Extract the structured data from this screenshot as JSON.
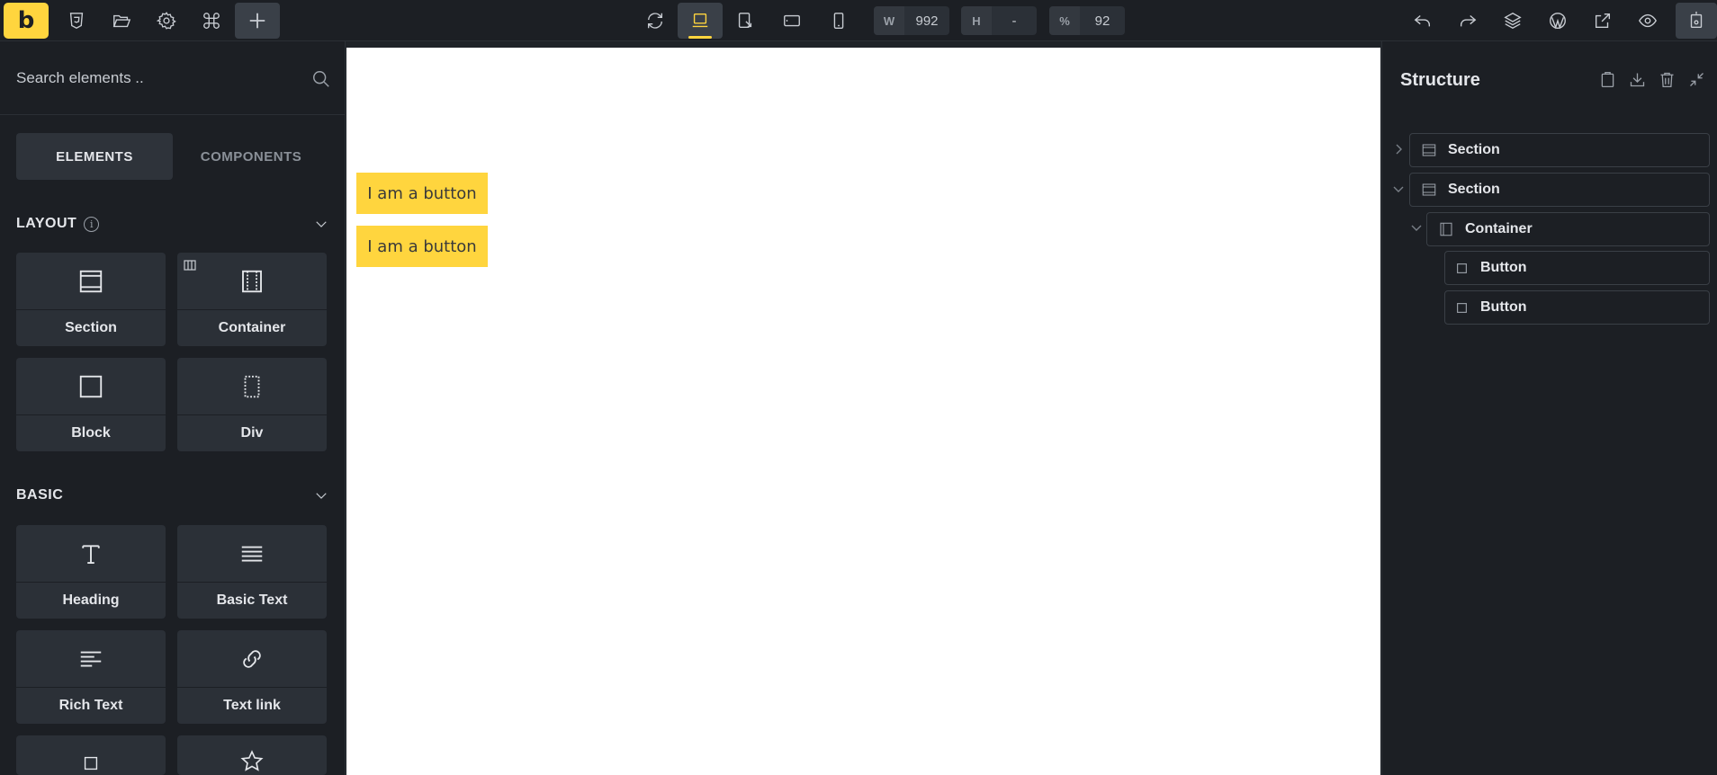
{
  "toolbar": {
    "logo": "b",
    "width_label": "W",
    "width_value": "992",
    "height_label": "H",
    "height_value": "-",
    "zoom_label": "%",
    "zoom_value": "92"
  },
  "left_panel": {
    "search_placeholder": "Search elements ..",
    "tabs": [
      {
        "label": "ELEMENTS",
        "active": true
      },
      {
        "label": "COMPONENTS",
        "active": false
      }
    ],
    "categories": {
      "layout": {
        "title": "LAYOUT",
        "info": "i",
        "elements": [
          "Section",
          "Container",
          "Block",
          "Div"
        ]
      },
      "basic": {
        "title": "BASIC",
        "elements": [
          "Heading",
          "Basic Text",
          "Rich Text",
          "Text link"
        ]
      }
    }
  },
  "canvas": {
    "buttons": [
      "I am a button",
      "I am a button"
    ]
  },
  "structure": {
    "title": "Structure",
    "nodes": [
      "Section",
      "Section",
      "Container",
      "Button",
      "Button"
    ]
  },
  "colors": {
    "accent": "#ffd53e",
    "panel_bg": "#1c1f24",
    "card_bg": "#2b3037"
  }
}
